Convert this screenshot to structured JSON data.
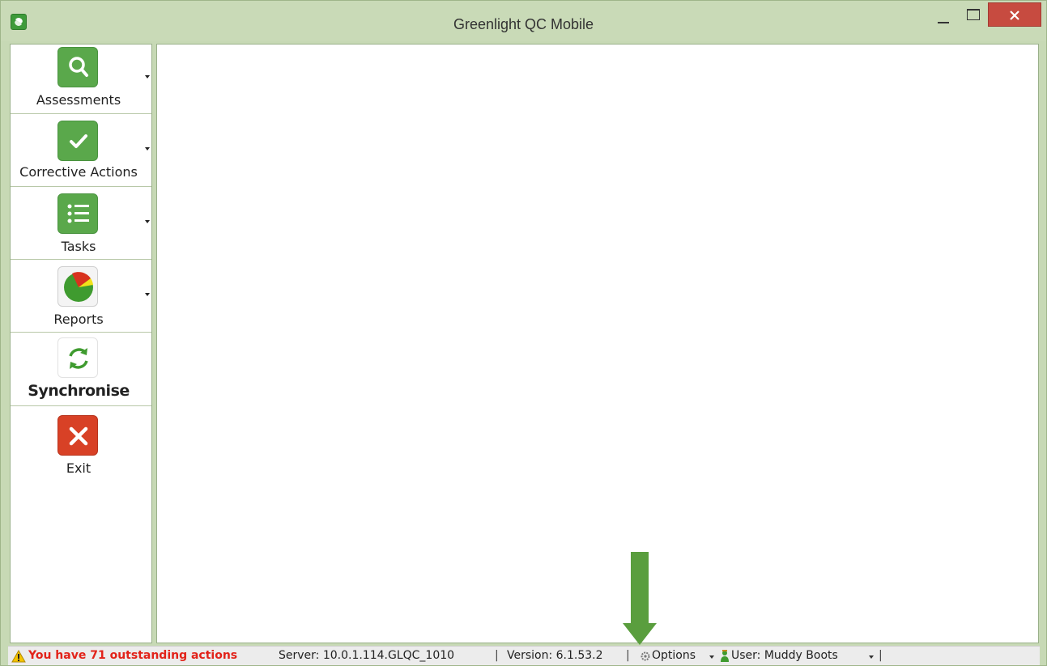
{
  "window": {
    "title": "Greenlight QC Mobile"
  },
  "sidebar": {
    "items": [
      {
        "label": "Assessments",
        "icon": "search-icon",
        "has_dropdown": true
      },
      {
        "label": "Corrective Actions",
        "icon": "check-icon",
        "has_dropdown": true
      },
      {
        "label": "Tasks",
        "icon": "list-icon",
        "has_dropdown": true
      },
      {
        "label": "Reports",
        "icon": "pie-chart-icon",
        "has_dropdown": true
      },
      {
        "label": "Synchronise",
        "icon": "sync-icon",
        "has_dropdown": false
      },
      {
        "label": "Exit",
        "icon": "close-icon",
        "has_dropdown": false
      }
    ]
  },
  "statusbar": {
    "outstanding": "You have 71 outstanding actions",
    "server": "Server: 10.0.1.114.GLQC_1010",
    "separator": "|",
    "version": "Version: 6.1.53.2",
    "options": "Options",
    "user": "User: Muddy Boots"
  },
  "colors": {
    "title_bar": "#c9dab7",
    "accent_green": "#5aa84b",
    "exit_red": "#d84126",
    "warning_text": "#e2231a",
    "annotation_arrow": "#5a9e3e"
  }
}
